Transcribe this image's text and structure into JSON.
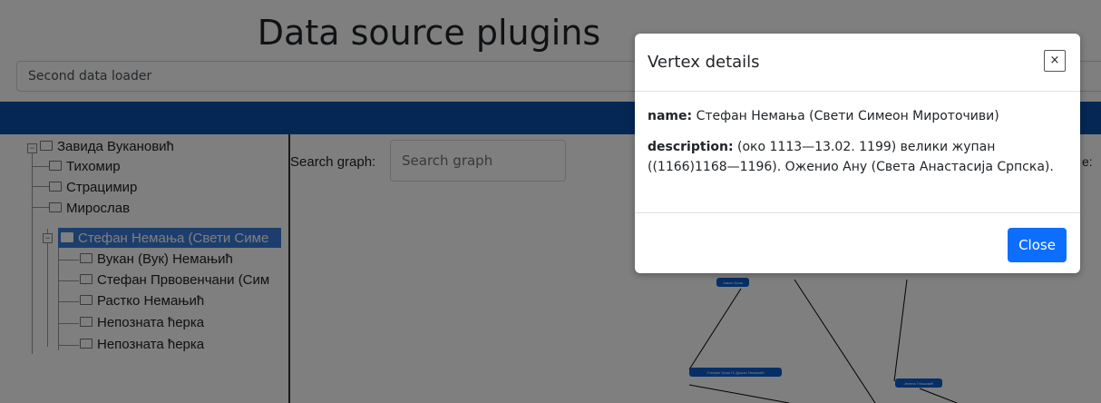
{
  "page": {
    "title": "Data source plugins",
    "selected_plugin": "Second data loader",
    "search_label": "Search graph:",
    "search_placeholder": "Search graph",
    "right_label_fragment": "e:"
  },
  "tree": {
    "root": "Завида Вукановић",
    "children": [
      "Тихомир",
      "Страцимир",
      "Мирослав"
    ],
    "selected": "Стефан Немања (Свети Симе",
    "grandchildren": [
      "Вукан (Вук) Немањић",
      "Стефан Првовенчани (Сим",
      "Растко Немањић",
      "Непозната ћерка",
      "Непозната ћерка"
    ]
  },
  "graph": {
    "nodes": [
      "Јован Урош",
      "Стефан Урош IV Душан Немањић",
      "Јелена Глишовић"
    ]
  },
  "modal": {
    "title": "Vertex details",
    "close_x": "×",
    "name_label": "name:",
    "name_value": "Стефан Немања (Свети Симеон Мироточиви)",
    "description_label": "description:",
    "description_value": "(око 1113—13.02. 1199) велики жупан ((1166)1168—1196). Оженио Ану (Света Анастасија Српска).",
    "close_button": "Close"
  },
  "colors": {
    "topbar": "#0a4ea8",
    "selected": "#3a7dd8",
    "primary_button": "#0d6efd"
  }
}
